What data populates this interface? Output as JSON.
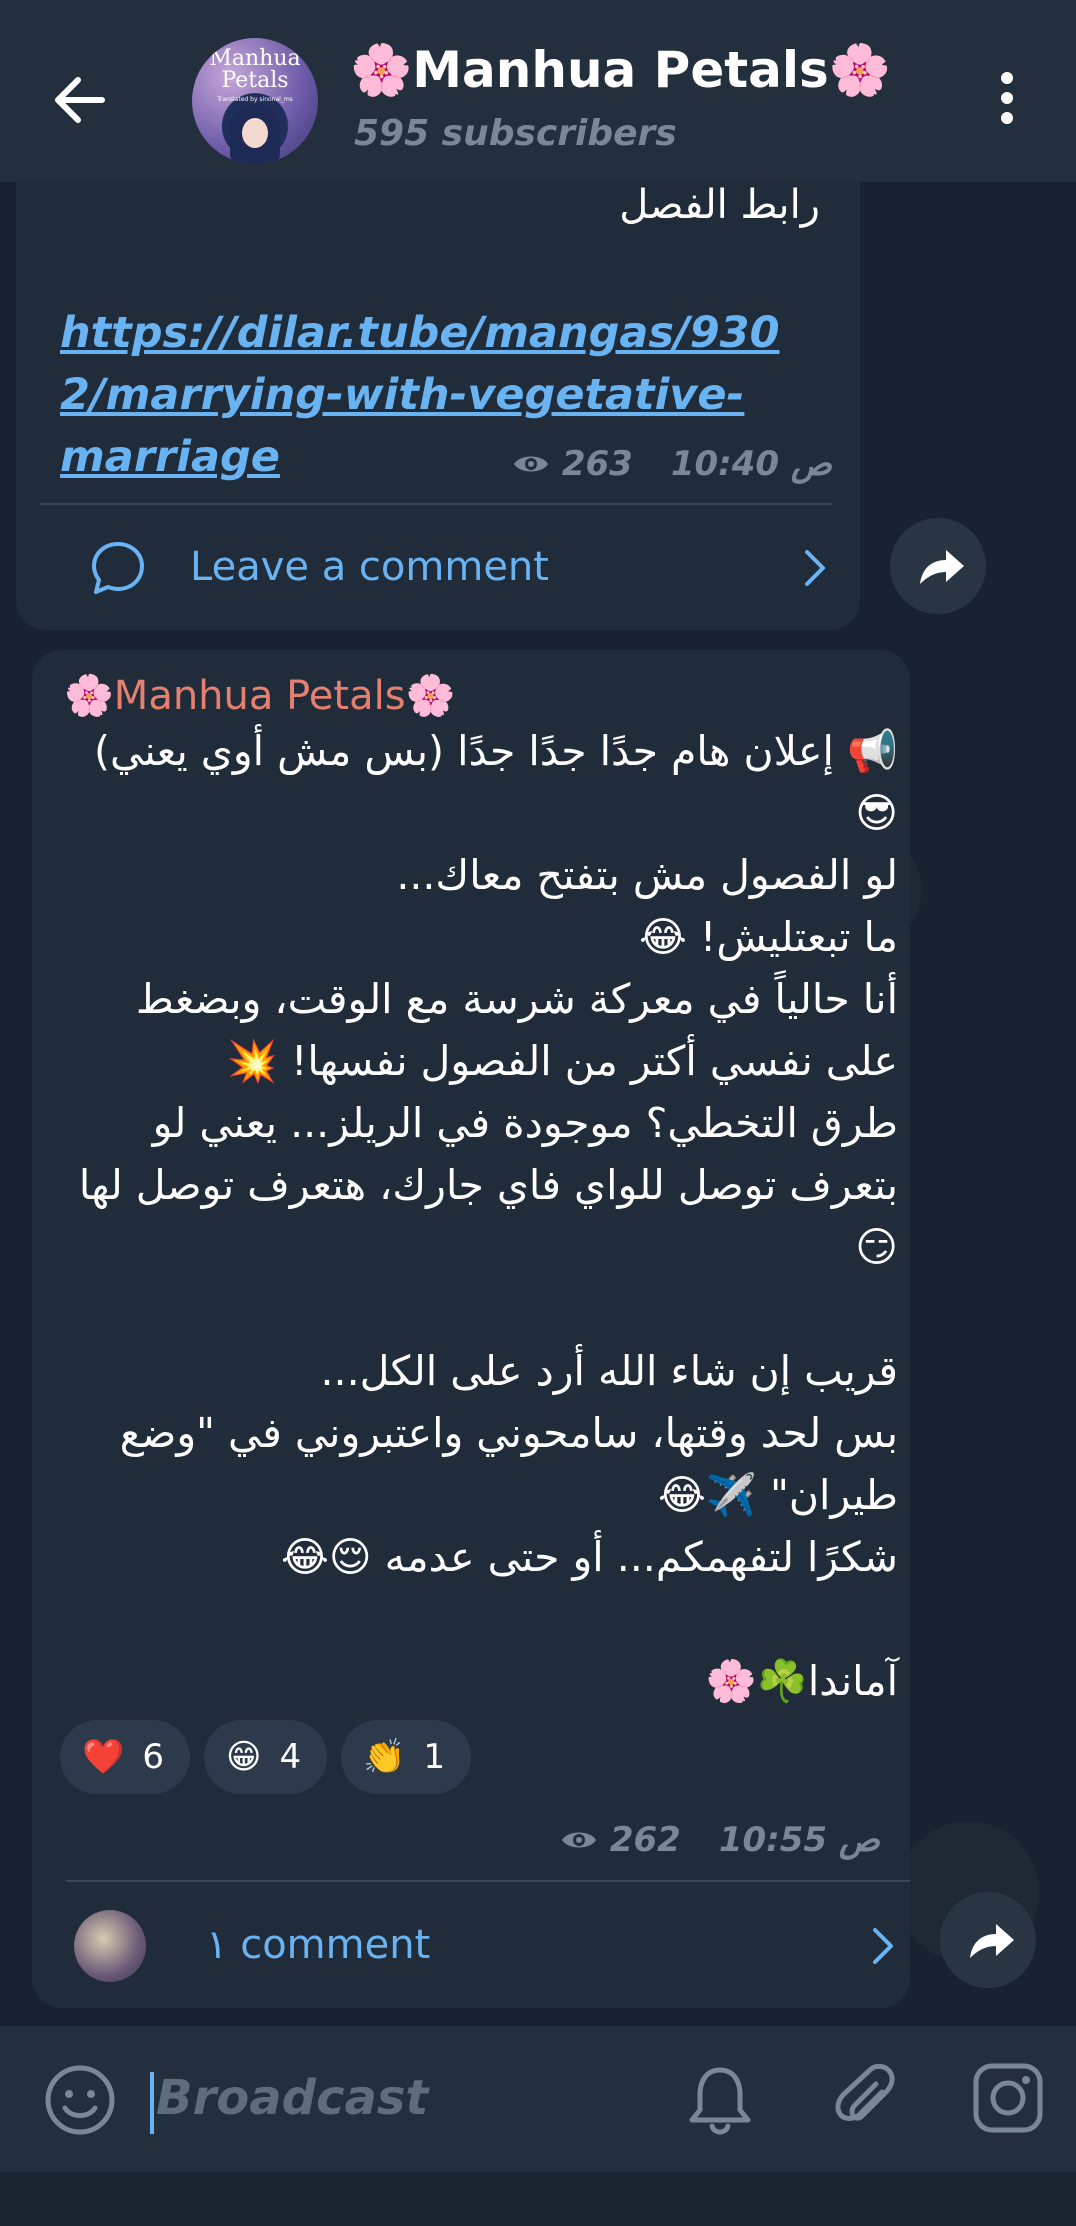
{
  "header": {
    "title": "🌸Manhua Petals🌸",
    "subtitle": "595 subscribers",
    "avatar_text": "Manhua Petals",
    "avatar_subtext": "Translated by sinonal_ms"
  },
  "post1": {
    "link_label": "رابط الفصل",
    "link": "https://dilar.tube/mangas/9302/marrying-with-vegetative-marriage",
    "views": "263",
    "time": "10:40 ص",
    "comment_label": "Leave a comment"
  },
  "post2": {
    "sender": "🌸Manhua Petals🌸",
    "message": "📢 إعلان هام جدًا جدًا جدًا (بس مش أوي يعني) 😎\nلو الفصول مش بتفتح معاك...\nما تبعتليش! 😂\nأنا حالياً في معركة شرسة مع الوقت، وبضغط على نفسي أكتر من الفصول نفسها! 💥\nطرق التخطي؟ موجودة في الريلز... يعني لو بتعرف توصل للواي فاي جارك، هتعرف توصل لها 😏\n\nقريب إن شاء الله أرد على الكل...\nبس لحد وقتها، سامحوني واعتبروني في \"وضع طيران\" ✈️😂\nشكرًا لتفهمكم... أو حتى عدمه 😌😂\n\nآماندا☘️🌸",
    "reactions": [
      {
        "emoji": "❤️",
        "count": "6"
      },
      {
        "emoji": "😁",
        "count": "4"
      },
      {
        "emoji": "👏",
        "count": "1"
      }
    ],
    "views": "262",
    "time": "10:55 ص",
    "comment_label": "١ comment"
  },
  "input": {
    "placeholder": "Broadcast"
  },
  "colors": {
    "accent": "#6ab3f3",
    "sender": "#e57f6f",
    "bubble": "#212c3a",
    "header": "#242f3d"
  }
}
